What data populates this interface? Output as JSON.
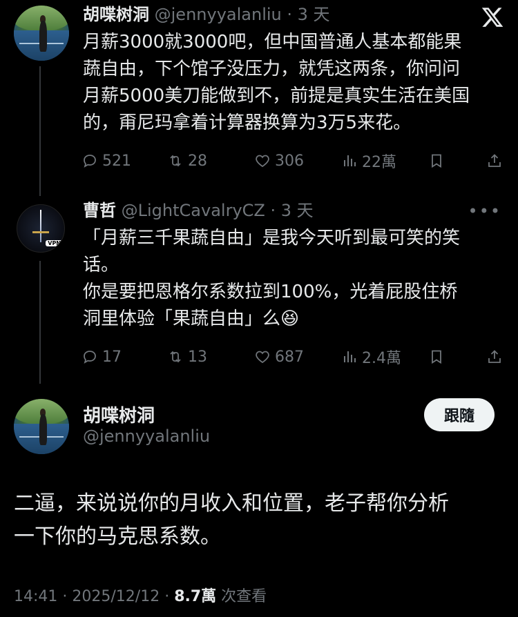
{
  "post1": {
    "name": "胡喋树洞",
    "handle": "@jennyyalanliu",
    "time": "3 天",
    "lines": [
      "月薪3000就3000吧，但中国普通人基本都能果",
      "蔬自由，下个馆子没压力，就凭这两条，你问问",
      "月薪5000美刀能做到不，前提是真实生活在美国",
      "的，甭尼玛拿着计算器换算为3万5来花。"
    ],
    "replies": "521",
    "reposts": "28",
    "likes": "306",
    "views": "22萬"
  },
  "post2": {
    "name": "曹哲",
    "handle": "@LightCavalryCZ",
    "time": "3 天",
    "lines": [
      "「月薪三千果蔬自由」是我今天听到最可笑的笑",
      "话。",
      "你是要把恩格尔系数拉到100%，光着屁股住桥",
      "洞里体验「果蔬自由」么😆"
    ],
    "replies": "17",
    "reposts": "13",
    "likes": "687",
    "views": "2.4萬",
    "avatar_badge": "VPN"
  },
  "main": {
    "name": "胡喋树洞",
    "handle": "@jennyyalanliu",
    "follow_label": "跟隨",
    "lines": [
      "二逼，来说说你的月收入和位置，老子帮你分析",
      "一下你的马克思系数。"
    ],
    "time": "14:41",
    "date": "2025/12/12",
    "views": "8.7萬",
    "views_label": "次查看"
  },
  "colors": {
    "background": "#000000",
    "text": "#e7e9ea",
    "muted": "#71767b",
    "button_bg": "#eff3f4"
  }
}
